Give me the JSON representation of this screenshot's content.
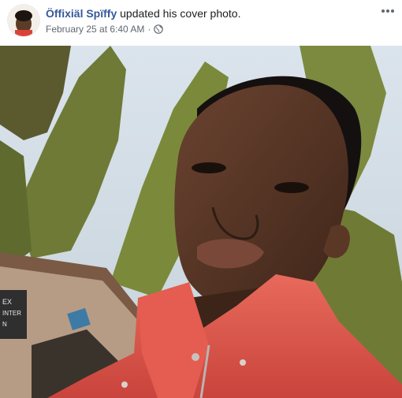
{
  "post": {
    "author_name": "Öffixiäl Spïffy",
    "action_text": "updated his cover photo.",
    "timestamp": "February 25 at 6:40 AM",
    "separator": "·",
    "privacy_icon": "globe-icon",
    "more_icon": "more-options-icon"
  },
  "photo": {
    "subject": "selfie-cover-photo",
    "sign_text": "EX INTER N"
  }
}
